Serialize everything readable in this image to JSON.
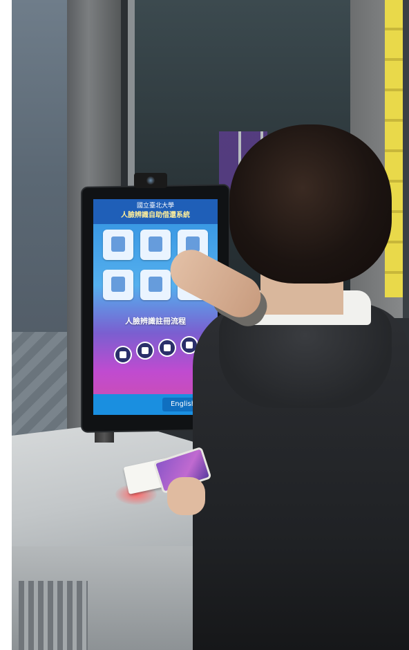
{
  "kiosk": {
    "school_name": "國立臺北大學",
    "system_title": "人臉辨識自助借還系統",
    "banner_text": "人臉辨識註冊流程",
    "language_button": "English"
  },
  "colors": {
    "screen_top": "#2f8fe0",
    "screen_bottom": "#d14fa8",
    "hair": "#1c1411",
    "jacket": "#2d2f33",
    "caution_tape": "#e9d94a"
  },
  "icons": [
    "service-tile-icon",
    "camera-icon",
    "document-icon",
    "registration-icon"
  ]
}
